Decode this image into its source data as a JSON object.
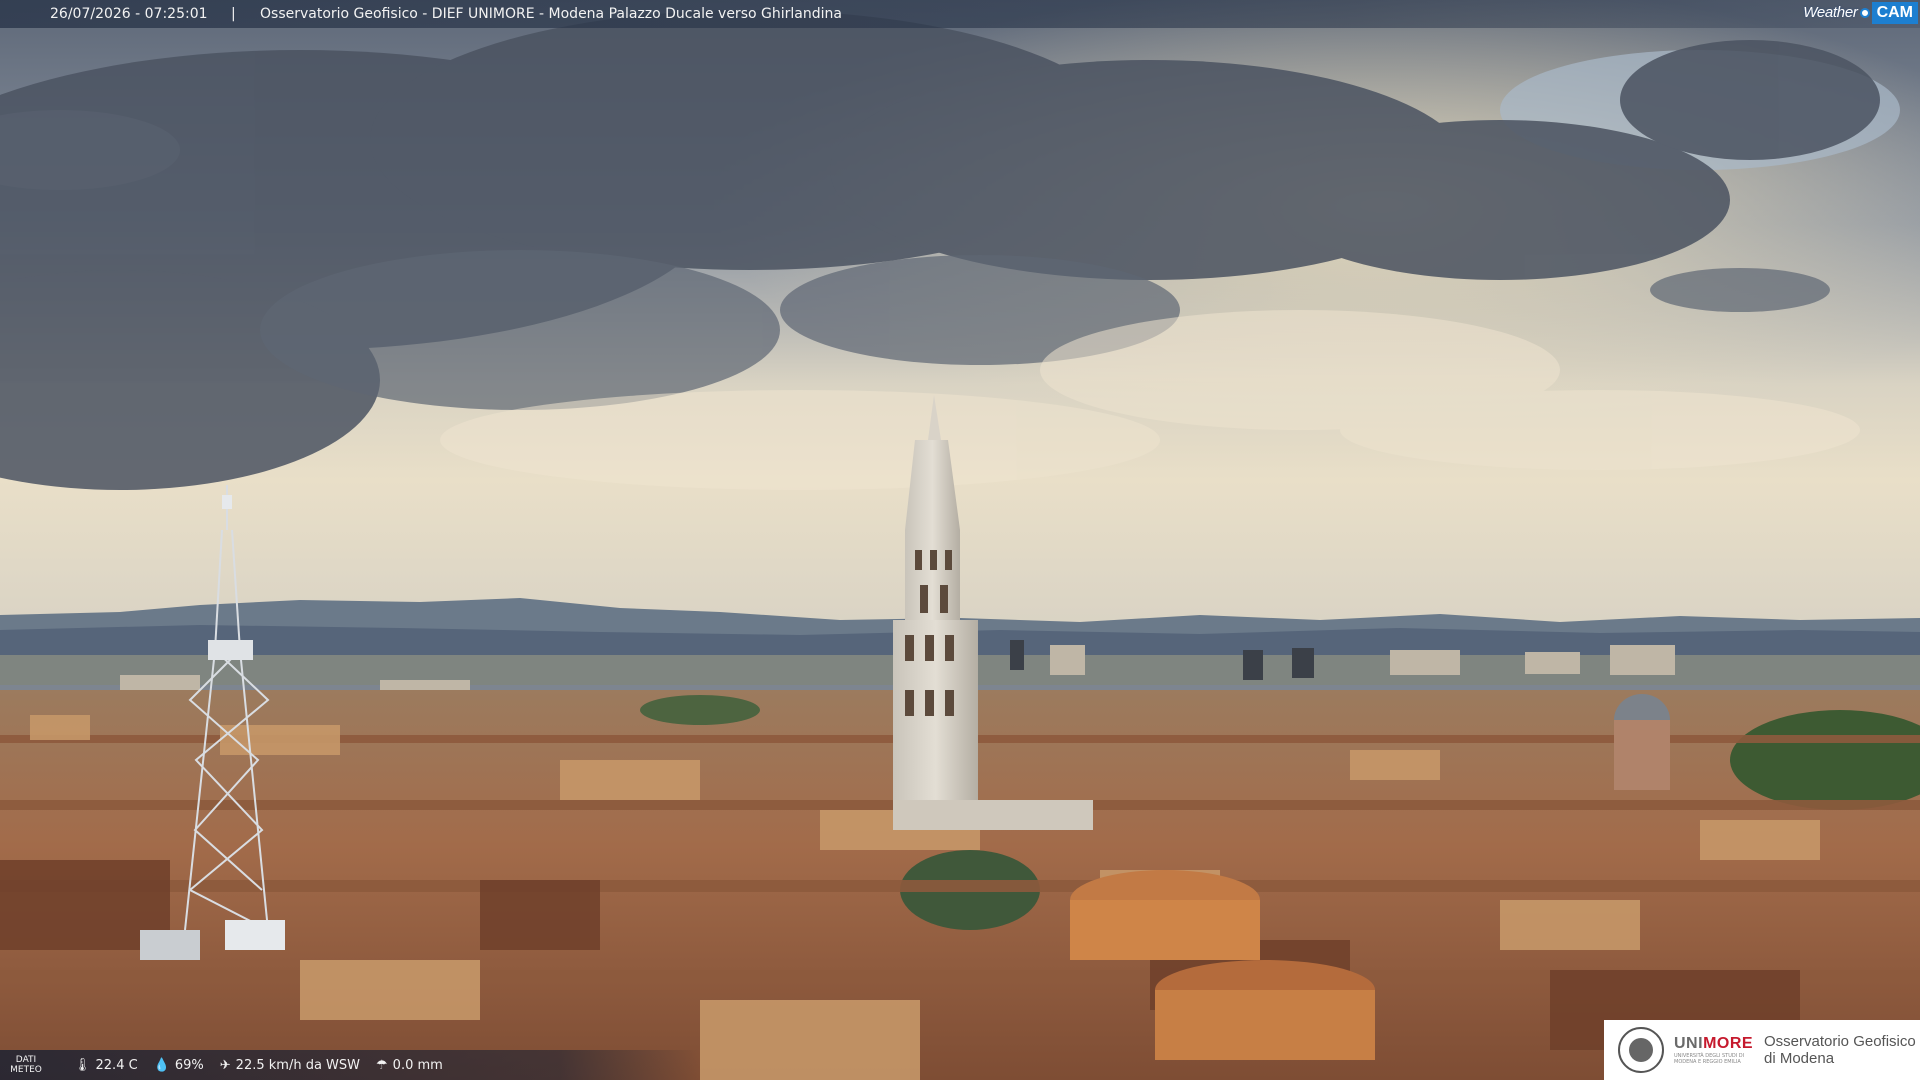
{
  "overlay": {
    "timestamp": "26/07/2026 - 07:25:01",
    "separator": "|",
    "location": "Osservatorio Geofisico - DIEF UNIMORE - Modena Palazzo Ducale verso Ghirlandina"
  },
  "logo": {
    "weather": "Weather",
    "cam": "CAM",
    "brand_color": "#1d7fd0"
  },
  "weather": {
    "label_line1": "DATI",
    "label_line2": "METEO",
    "temperature": "22.4 C",
    "humidity": "69%",
    "wind": "22.5 km/h da WSW",
    "rain": "0.0 mm",
    "icons": [
      "thermometer-icon",
      "humidity-drop-icon",
      "wind-icon",
      "rain-icon"
    ]
  },
  "badge": {
    "uni_prefix": "UNI",
    "uni_suffix": "MORE",
    "uni_sub_line1": "UNIVERSITÀ DEGLI STUDI DI",
    "uni_sub_line2": "MODENA E REGGIO EMILIA",
    "obs_line1": "Osservatorio Geofisico",
    "obs_line2": "di Modena",
    "accent": "#c61a2e"
  }
}
